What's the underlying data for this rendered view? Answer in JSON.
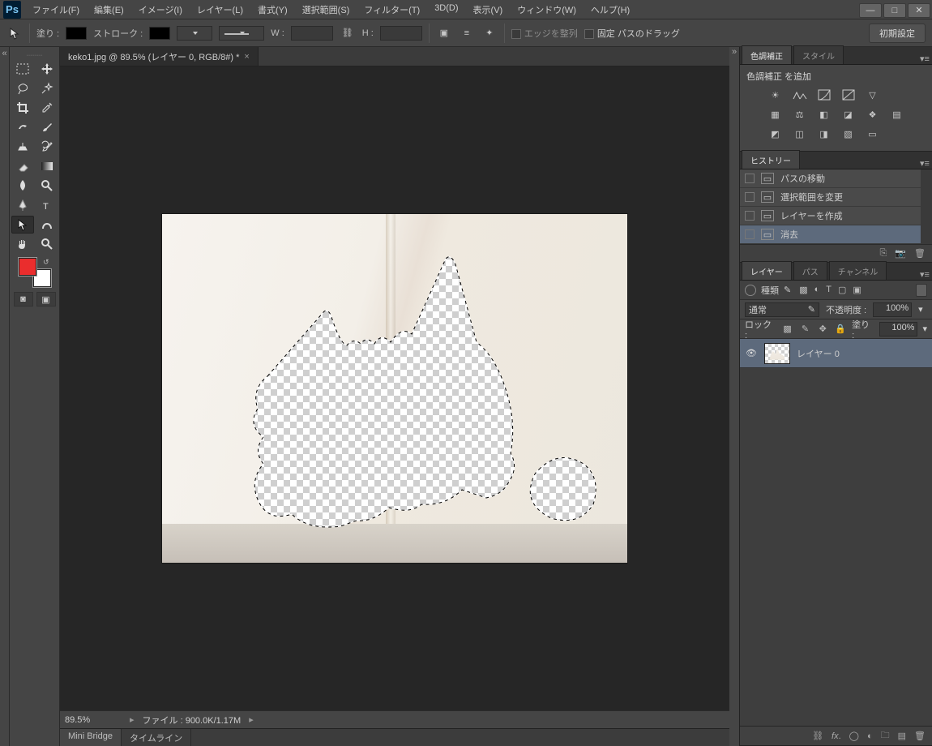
{
  "app_logo_text": "Ps",
  "menubar": [
    "ファイル(F)",
    "編集(E)",
    "イメージ(I)",
    "レイヤー(L)",
    "書式(Y)",
    "選択範囲(S)",
    "フィルター(T)",
    "3D(D)",
    "表示(V)",
    "ウィンドウ(W)",
    "ヘルプ(H)"
  ],
  "window_controls": {
    "minimize": "—",
    "maximize": "□",
    "close": "✕"
  },
  "optionsbar": {
    "fill_label": "塗り :",
    "stroke_label": "ストローク :",
    "w_label": "W :",
    "h_label": "H :",
    "align_edges_label": "エッジを整列",
    "fixed_path_drag_label": "固定 パスのドラッグ",
    "reset_button": "初期設定"
  },
  "doc": {
    "tab_title": "keko1.jpg @ 89.5% (レイヤー 0, RGB/8#) *",
    "close_glyph": "×"
  },
  "statusbar": {
    "zoom": "89.5%",
    "file_info": "ファイル : 900.0K/1.17M"
  },
  "bottom_tabs": [
    "Mini Bridge",
    "タイムライン"
  ],
  "panels": {
    "adjustments": {
      "tabs": [
        "色調補正",
        "スタイル"
      ],
      "label": "色調補正 を追加"
    },
    "history": {
      "tab": "ヒストリー",
      "items": [
        "パスの移動",
        "選択範囲を変更",
        "レイヤーを作成",
        "消去"
      ],
      "selected_index": 3
    },
    "layers": {
      "tabs": [
        "レイヤー",
        "パス",
        "チャンネル"
      ],
      "filter_type": "種類",
      "blend_mode": "通常",
      "opacity_label": "不透明度 :",
      "opacity_value": "100%",
      "lock_label": "ロック :",
      "fill_label": "塗り :",
      "fill_value": "100%",
      "layer0_name": "レイヤー 0"
    }
  },
  "colors": {
    "foreground": "#ea2d2d",
    "background": "#ffffff"
  }
}
